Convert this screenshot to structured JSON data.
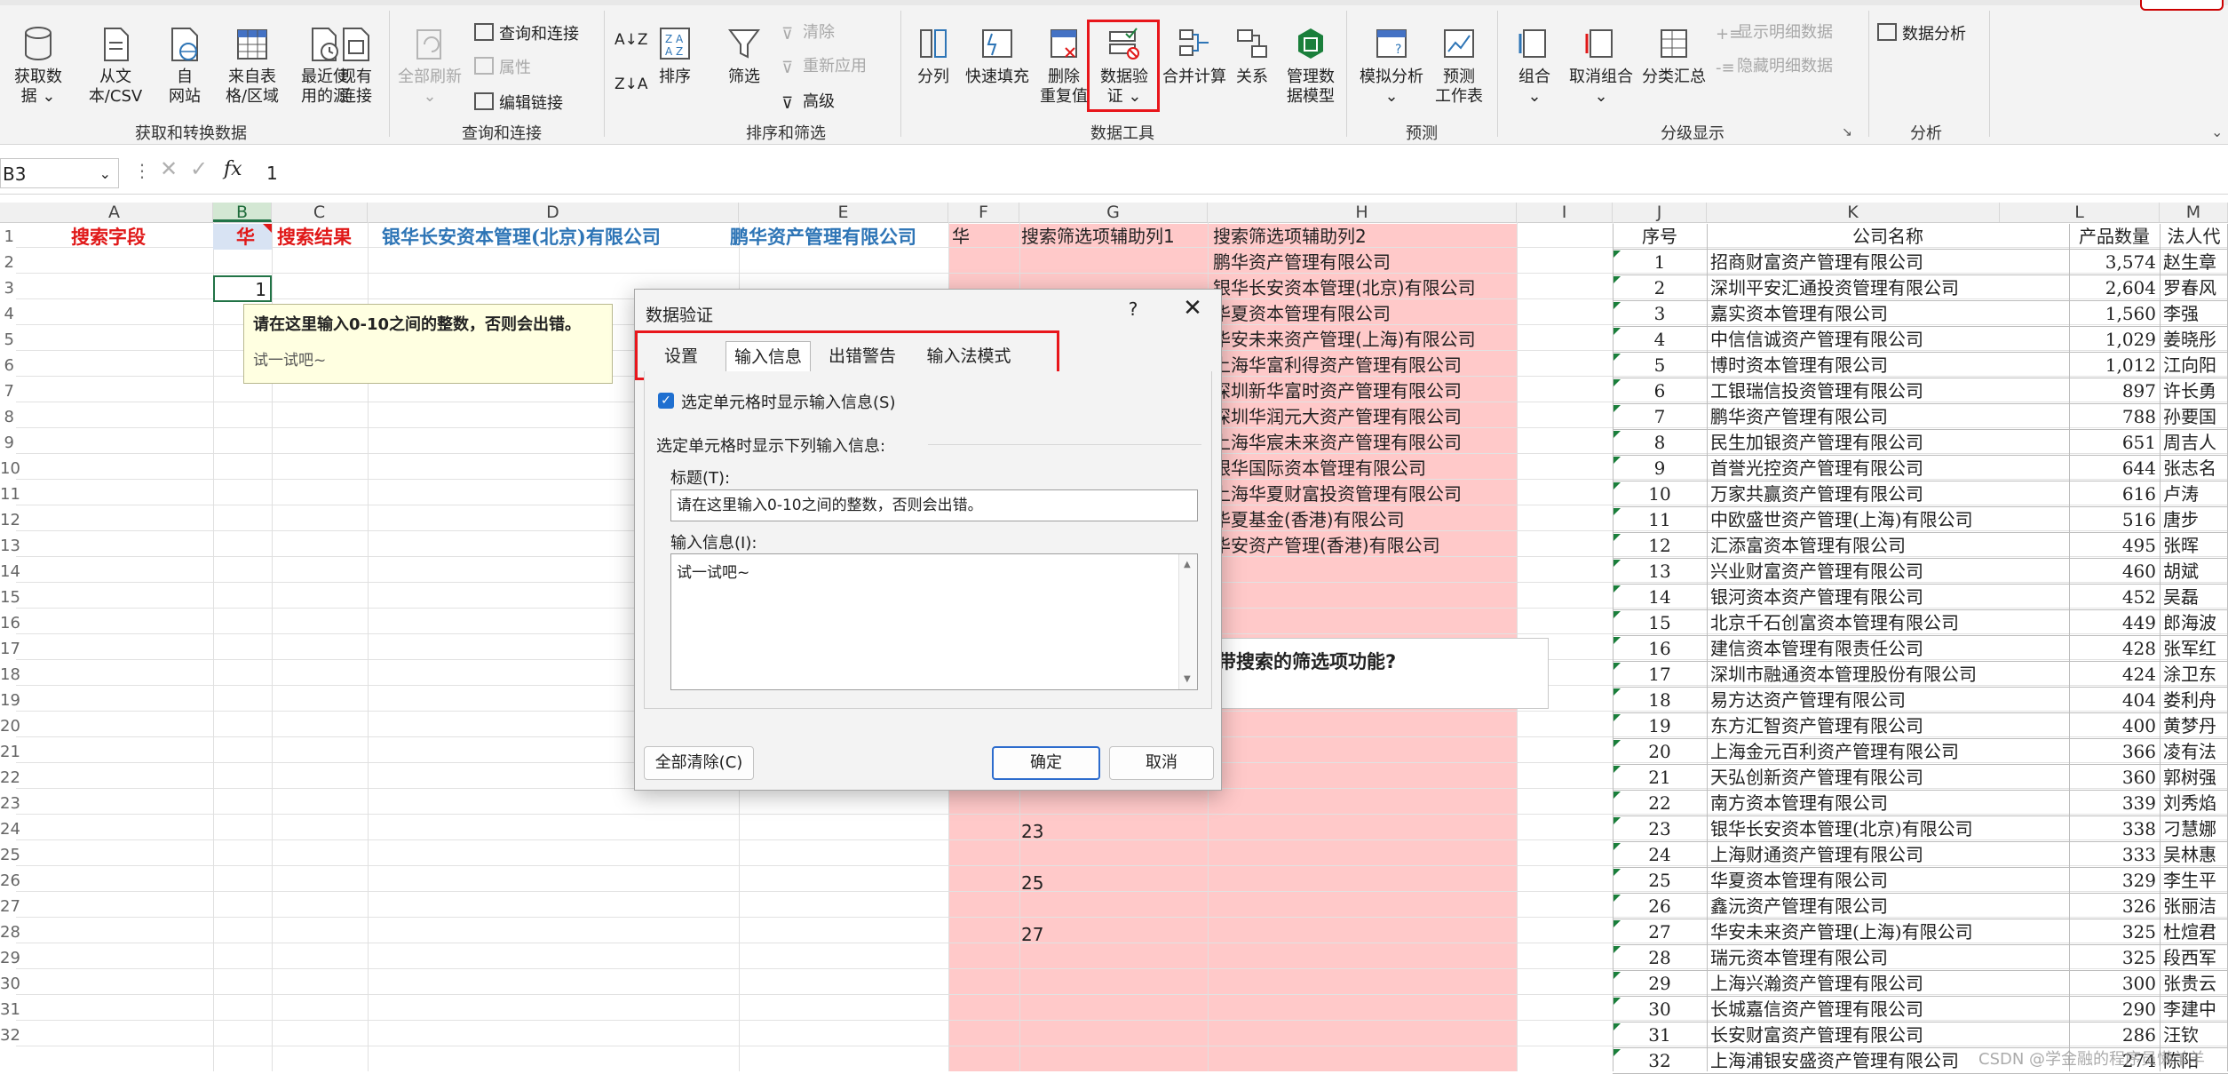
{
  "ribbon": {
    "get_transform": {
      "label": "获取和转换数据",
      "buttons": [
        {
          "label": "获取数\n据 ⌄",
          "icon": "database-icon"
        },
        {
          "label": "从文\n本/CSV",
          "icon": "text-file-icon"
        },
        {
          "label": "自\n网站",
          "icon": "web-icon"
        },
        {
          "label": "来自表\n格/区域",
          "icon": "table-icon"
        },
        {
          "label": "最近使\n用的源",
          "icon": "recent-sources-icon"
        },
        {
          "label": "现有\n连接",
          "icon": "existing-connections-icon"
        }
      ]
    },
    "queries": {
      "label": "查询和连接",
      "refresh_all": "全部刷新",
      "queries_connections": "查询和连接",
      "properties": "属性",
      "edit_links": "编辑链接"
    },
    "sort_filter": {
      "label": "排序和筛选",
      "sort": "排序",
      "filter": "筛选",
      "clear": "清除",
      "reapply": "重新应用",
      "advanced": "高级"
    },
    "data_tools": {
      "label": "数据工具",
      "text_to_columns": "分列",
      "flash_fill": "快速填充",
      "remove_duplicates": "删除\n重复值",
      "data_validation": "数据验\n证 ⌄",
      "consolidate": "合并计算",
      "relationships": "关系",
      "manage_model": "管理数\n据模型"
    },
    "forecast": {
      "label": "预测",
      "what_if": "模拟分析\n⌄",
      "forecast_sheet": "预测\n工作表"
    },
    "outline": {
      "label": "分级显示",
      "group": "组合\n⌄",
      "ungroup": "取消组合\n⌄",
      "subtotal": "分类汇总",
      "show_detail": "显示明细数据",
      "hide_detail": "隐藏明细数据"
    },
    "analysis": {
      "label": "分析",
      "data_analysis": "数据分析"
    }
  },
  "formula_bar": {
    "name_box": "B3",
    "fx": "fx",
    "value": "1"
  },
  "columns": [
    "A",
    "B",
    "C",
    "D",
    "E",
    "F",
    "G",
    "H",
    "I",
    "J",
    "K",
    "L",
    "M"
  ],
  "row_numbers": [
    "1",
    "2",
    "3",
    "4",
    "5",
    "6",
    "7",
    "8",
    "9",
    "10",
    "11",
    "12",
    "13",
    "14",
    "15",
    "16",
    "17",
    "18",
    "19",
    "20",
    "21",
    "22",
    "23",
    "24",
    "25",
    "26",
    "27",
    "28",
    "29",
    "30",
    "31",
    "32"
  ],
  "sheet": {
    "search_field": "搜索字段",
    "b1": "华",
    "search_result": "搜索结果",
    "d1": "银华长安资本管理(北京)有限公司",
    "e1": "鹏华资产管理有限公司",
    "f1": "华",
    "g1": "搜索筛选项辅助列1",
    "h1": "搜索筛选项辅助列2",
    "b3": "1",
    "h_list": [
      "鹏华资产管理有限公司",
      "银华长安资本管理(北京)有限公司",
      "华夏资本管理有限公司",
      "华安未来资产管理(上海)有限公司",
      "上海华富利得资产管理有限公司",
      "深圳新华富时资产管理有限公司",
      "深圳华润元大资产管理有限公司",
      "上海华宸未来资产管理有限公司",
      "银华国际资本管理有限公司",
      "上海华夏财富投资管理有限公司",
      "华夏基金(香港)有限公司",
      "华安资产管理(香港)有限公司"
    ],
    "g_numbers": [
      "23",
      "25",
      "27"
    ],
    "question": "带搜索的筛选项功能?"
  },
  "input_tip": {
    "title": "请在这里输入0-10之间的整数，否则会出错。",
    "message": "试一试吧~"
  },
  "table": {
    "headers": [
      "序号",
      "公司名称",
      "产品数量",
      "法人代"
    ],
    "rows": [
      [
        "1",
        "招商财富资产管理有限公司",
        "3,574",
        "赵生章"
      ],
      [
        "2",
        "深圳平安汇通投资管理有限公司",
        "2,604",
        "罗春风"
      ],
      [
        "3",
        "嘉实资本管理有限公司",
        "1,560",
        "李强"
      ],
      [
        "4",
        "中信信诚资产管理有限公司",
        "1,029",
        "姜晓彤"
      ],
      [
        "5",
        "博时资本管理有限公司",
        "1,012",
        "江向阳"
      ],
      [
        "6",
        "工银瑞信投资管理有限公司",
        "897",
        "许长勇"
      ],
      [
        "7",
        "鹏华资产管理有限公司",
        "788",
        "孙要国"
      ],
      [
        "8",
        "民生加银资产管理有限公司",
        "651",
        "周吉人"
      ],
      [
        "9",
        "首誉光控资产管理有限公司",
        "644",
        "张志名"
      ],
      [
        "10",
        "万家共赢资产管理有限公司",
        "616",
        "卢涛"
      ],
      [
        "11",
        "中欧盛世资产管理(上海)有限公司",
        "516",
        "唐步"
      ],
      [
        "12",
        "汇添富资本管理有限公司",
        "495",
        "张晖"
      ],
      [
        "13",
        "兴业财富资产管理有限公司",
        "460",
        "胡斌"
      ],
      [
        "14",
        "银河资本资产管理有限公司",
        "452",
        "吴磊"
      ],
      [
        "15",
        "北京千石创富资本管理有限公司",
        "449",
        "郎海波"
      ],
      [
        "16",
        "建信资本管理有限责任公司",
        "428",
        "张军红"
      ],
      [
        "17",
        "深圳市融通资本管理股份有限公司",
        "424",
        "涂卫东"
      ],
      [
        "18",
        "易方达资产管理有限公司",
        "404",
        "娄利舟"
      ],
      [
        "19",
        "东方汇智资产管理有限公司",
        "400",
        "黄梦丹"
      ],
      [
        "20",
        "上海金元百利资产管理有限公司",
        "366",
        "凌有法"
      ],
      [
        "21",
        "天弘创新资产管理有限公司",
        "360",
        "郭树强"
      ],
      [
        "22",
        "南方资本管理有限公司",
        "339",
        "刘秀焰"
      ],
      [
        "23",
        "银华长安资本管理(北京)有限公司",
        "338",
        "刁慧娜"
      ],
      [
        "24",
        "上海财通资产管理有限公司",
        "333",
        "吴林惠"
      ],
      [
        "25",
        "华夏资本管理有限公司",
        "329",
        "李生平"
      ],
      [
        "26",
        "鑫沅资产管理有限公司",
        "326",
        "张丽洁"
      ],
      [
        "27",
        "华安未来资产管理(上海)有限公司",
        "325",
        "杜煊君"
      ],
      [
        "28",
        "瑞元资本管理有限公司",
        "325",
        "段西军"
      ],
      [
        "29",
        "上海兴瀚资产管理有限公司",
        "300",
        "张贵云"
      ],
      [
        "30",
        "长城嘉信资产管理有限公司",
        "290",
        "李建中"
      ],
      [
        "31",
        "长安财富资产管理有限公司",
        "286",
        "汪钦"
      ],
      [
        "32",
        "上海浦银安盛资产管理有限公司",
        "274",
        "陈阳"
      ]
    ]
  },
  "dialog": {
    "title": "数据验证",
    "help": "?",
    "close": "✕",
    "tabs": [
      "设置",
      "输入信息",
      "出错警告",
      "输入法模式"
    ],
    "active_tab": "输入信息",
    "checkbox_checked": true,
    "checkbox_label": "选定单元格时显示输入信息(S)",
    "section_label": "选定单元格时显示下列输入信息:",
    "title_label": "标题(T):",
    "title_value": "请在这里输入0-10之间的整数，否则会出错。",
    "message_label": "输入信息(I):",
    "message_value": "试一试吧~",
    "clear_all": "全部清除(C)",
    "ok": "确定",
    "cancel": "取消"
  },
  "watermark": "CSDN @学金融的程序员懒羊羊",
  "colors": {
    "highlight_red": "#e8161b",
    "pink_band": "#ffc9c9",
    "header_red": "#e01818",
    "header_blue": "#2e75b6",
    "excel_green": "#217346"
  }
}
